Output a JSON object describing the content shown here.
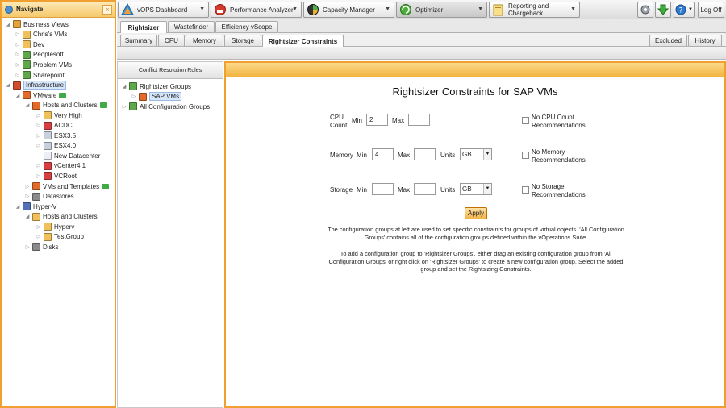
{
  "nav": {
    "title": "Navigate",
    "collapse_label": "«",
    "tree": [
      {
        "label": "Business Views",
        "icon": "business-views-icon"
      },
      {
        "label": "Chris's VMs",
        "icon": "folder-icon"
      },
      {
        "label": "Dev",
        "icon": "folder-icon"
      },
      {
        "label": "Peoplesoft",
        "icon": "folder-icon"
      },
      {
        "label": "Problem VMs",
        "icon": "folder-icon"
      },
      {
        "label": "Sharepoint",
        "icon": "folder-icon"
      },
      {
        "label": "Infrastructure",
        "icon": "infrastructure-icon"
      },
      {
        "label": "VMware",
        "icon": "vmware-icon"
      },
      {
        "label": "Hosts and Clusters",
        "icon": "hosts-clusters-icon"
      },
      {
        "label": "Very High",
        "icon": "folder-icon"
      },
      {
        "label": "ACDC",
        "icon": "host-icon"
      },
      {
        "label": "ESX3.5",
        "icon": "host-icon"
      },
      {
        "label": "ESX4.0",
        "icon": "host-icon"
      },
      {
        "label": "New Datacenter",
        "icon": "datacenter-icon"
      },
      {
        "label": "vCenter4.1",
        "icon": "vcenter-icon"
      },
      {
        "label": "VCRoot",
        "icon": "vcenter-icon"
      },
      {
        "label": "VMs and Templates",
        "icon": "vms-templates-icon"
      },
      {
        "label": "Datastores",
        "icon": "datastores-icon"
      },
      {
        "label": "Hyper-V",
        "icon": "hyperv-icon"
      },
      {
        "label": "Hosts and Clusters",
        "icon": "hosts-clusters-icon"
      },
      {
        "label": "Hyperv",
        "icon": "folder-icon"
      },
      {
        "label": "TestGroup",
        "icon": "folder-icon"
      },
      {
        "label": "Disks",
        "icon": "disks-icon"
      }
    ]
  },
  "toolbar": {
    "vops_dashboard": "vOPS Dashboard",
    "performance_analyzer": "Performance Analyzer",
    "capacity_manager": "Capacity Manager",
    "optimizer": "Optimizer",
    "reporting": "Reporting and Chargeback",
    "log_off": "Log Off"
  },
  "tabs": {
    "top": [
      "Rightsizer",
      "Wastefinder",
      "Efficiency vScope"
    ],
    "sub": [
      "Summary",
      "CPU",
      "Memory",
      "Storage",
      "Rightsizer Constraints"
    ],
    "right": [
      "Excluded",
      "History"
    ]
  },
  "conflict_panel": {
    "header": "Conflict Resolution Rules",
    "tree": [
      {
        "label": "Rightsizer Groups"
      },
      {
        "label": "SAP VMs"
      },
      {
        "label": "All Configuration Groups"
      }
    ]
  },
  "main": {
    "title": "Rightsizer Constraints for SAP VMs",
    "cpu_label": "CPU Count",
    "memory_label": "Memory",
    "storage_label": "Storage",
    "min_label": "Min",
    "max_label": "Max",
    "units_label": "Units",
    "cpu_min": "2",
    "cpu_max": "",
    "memory_min": "4",
    "memory_max": "",
    "memory_units": "GB",
    "storage_min": "",
    "storage_max": "",
    "storage_units": "GB",
    "no_cpu": "No CPU Count Recommendations",
    "no_memory": "No Memory Recommendations",
    "no_storage": "No Storage Recommendations",
    "apply": "Apply",
    "info1": "The configuration groups at left are used to set specific constraints for groups of virtual objects. 'All Configuration Groups' contains all of the configuration groups defined within the vOperations Suite.",
    "info2": "To add a configuration group to 'Rightsizer Groups', either drag an existing configuration group from 'All Configuration Groups' or right click on 'Rightsizer Groups' to create a new configuration group. Select the added group and set the Rightsizing Constraints."
  }
}
